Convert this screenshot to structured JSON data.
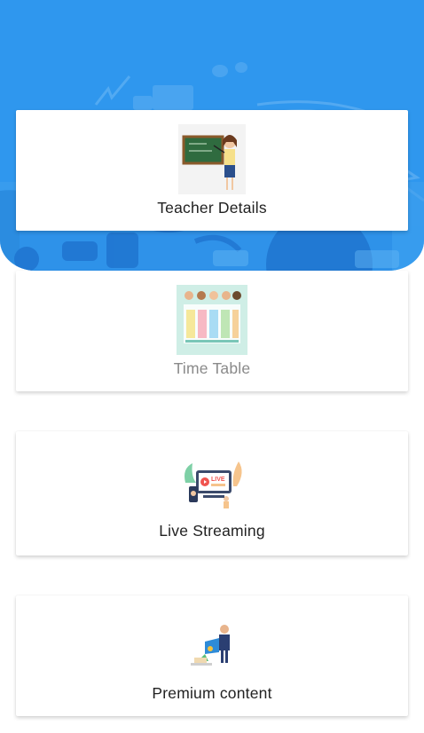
{
  "cards": [
    {
      "label": "Teacher Details",
      "icon": "teacher-illustration-icon"
    },
    {
      "label": "Time Table",
      "icon": "timetable-illustration-icon"
    },
    {
      "label": "Live Streaming",
      "icon": "live-streaming-illustration-icon"
    },
    {
      "label": "Premium content",
      "icon": "premium-content-illustration-icon"
    }
  ],
  "live_badge": "LIVE",
  "colors": {
    "header": "#2f97ee",
    "card": "#ffffff",
    "text": "#222222",
    "faded_text": "#8a8a8a"
  }
}
